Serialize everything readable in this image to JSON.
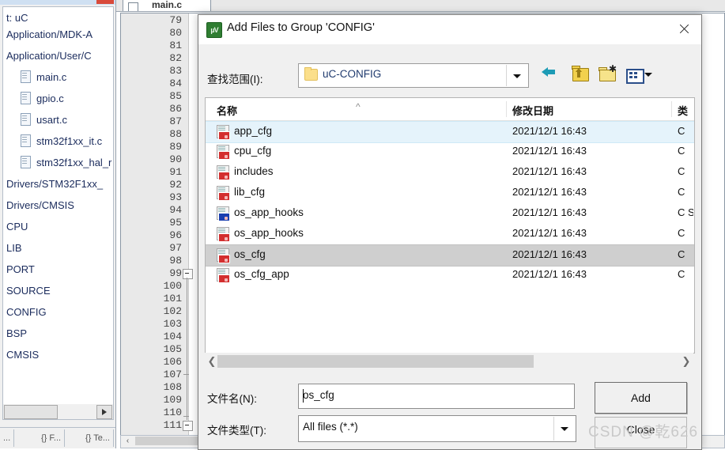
{
  "ide": {
    "project_panel": {
      "header_text": "t: uC",
      "tree_items": [
        {
          "label": "Application/MDK-A",
          "indent": false,
          "icon": null
        },
        {
          "label": "Application/User/C",
          "indent": false,
          "icon": null
        },
        {
          "label": "main.c",
          "indent": true,
          "icon": "document-icon"
        },
        {
          "label": "gpio.c",
          "indent": true,
          "icon": "document-icon"
        },
        {
          "label": "usart.c",
          "indent": true,
          "icon": "document-icon"
        },
        {
          "label": "stm32f1xx_it.c",
          "indent": true,
          "icon": "document-icon"
        },
        {
          "label": "stm32f1xx_hal_r",
          "indent": true,
          "icon": "document-icon"
        },
        {
          "label": "Drivers/STM32F1xx_",
          "indent": false,
          "icon": null
        },
        {
          "label": "Drivers/CMSIS",
          "indent": false,
          "icon": null
        },
        {
          "label": "CPU",
          "indent": false,
          "icon": null
        },
        {
          "label": "LIB",
          "indent": false,
          "icon": null
        },
        {
          "label": "PORT",
          "indent": false,
          "icon": null
        },
        {
          "label": "SOURCE",
          "indent": false,
          "icon": null
        },
        {
          "label": "CONFIG",
          "indent": false,
          "icon": null
        },
        {
          "label": "BSP",
          "indent": false,
          "icon": null
        },
        {
          "label": "CMSIS",
          "indent": false,
          "icon": null
        }
      ],
      "bottom_tabs": [
        {
          "label": "..."
        },
        {
          "label": "{} F..."
        },
        {
          "label": "{} Te..."
        }
      ]
    },
    "editor": {
      "tab_label": "main.c",
      "line_numbers": [
        79,
        80,
        81,
        82,
        83,
        84,
        85,
        86,
        87,
        88,
        89,
        90,
        91,
        92,
        93,
        94,
        95,
        96,
        97,
        98,
        99,
        100,
        101,
        102,
        103,
        104,
        105,
        106,
        107,
        108,
        109,
        110,
        111
      ],
      "code_marks": [
        {
          "line": 109,
          "text": "}"
        },
        {
          "line": 111,
          "text": "/"
        }
      ]
    }
  },
  "dialog": {
    "title": "Add Files to Group 'CONFIG'",
    "icon": "uvision-icon",
    "close_icon": "close-icon",
    "look_in": {
      "label": "查找范围(I):",
      "value": "uC-CONFIG",
      "folder_icon": "folder-icon",
      "dropdown_icon": "chevron-down-icon"
    },
    "toolbar": [
      {
        "name": "back-icon",
        "title": "后退"
      },
      {
        "name": "up-folder-icon",
        "title": "上一级"
      },
      {
        "name": "new-folder-icon",
        "title": "新建文件夹"
      },
      {
        "name": "views-icon",
        "title": "视图"
      }
    ],
    "file_list": {
      "columns": [
        "名称",
        "修改日期",
        "类"
      ],
      "sort_indicator": "caret-up-icon",
      "rows": [
        {
          "name": "app_cfg",
          "date": "2021/12/1 16:43",
          "type": "C ",
          "icon_badge": "red",
          "state": "hover"
        },
        {
          "name": "cpu_cfg",
          "date": "2021/12/1 16:43",
          "type": "C ",
          "icon_badge": "red",
          "state": "normal"
        },
        {
          "name": "includes",
          "date": "2021/12/1 16:43",
          "type": "C ",
          "icon_badge": "red",
          "state": "normal"
        },
        {
          "name": "lib_cfg",
          "date": "2021/12/1 16:43",
          "type": "C ",
          "icon_badge": "red",
          "state": "normal"
        },
        {
          "name": "os_app_hooks",
          "date": "2021/12/1 16:43",
          "type": "C S",
          "icon_badge": "blue",
          "state": "normal"
        },
        {
          "name": "os_app_hooks",
          "date": "2021/12/1 16:43",
          "type": "C ",
          "icon_badge": "red",
          "state": "normal"
        },
        {
          "name": "os_cfg",
          "date": "2021/12/1 16:43",
          "type": "C ",
          "icon_badge": "red",
          "state": "selected"
        },
        {
          "name": "os_cfg_app",
          "date": "2021/12/1 16:43",
          "type": "C ",
          "icon_badge": "red",
          "state": "normal"
        }
      ],
      "hscroll_left_icon": "chevron-left-icon",
      "hscroll_right_icon": "chevron-right-icon"
    },
    "file_name": {
      "label": "文件名(N):",
      "value": "os_cfg",
      "placeholder": ""
    },
    "file_type": {
      "label": "文件类型(T):",
      "value": "All files (*.*)",
      "dropdown_icon": "chevron-down-icon"
    },
    "buttons": {
      "add_label": "Add",
      "close_label": "Close"
    }
  },
  "watermark": "CSDN @乾626",
  "colors": {
    "hover_row": "#e5f3fb",
    "selected_row": "#cfcfcf",
    "link_text": "#1f3a6e",
    "tree_text": "#1a2b5c",
    "dialog_bg": "#f0f0f0"
  }
}
